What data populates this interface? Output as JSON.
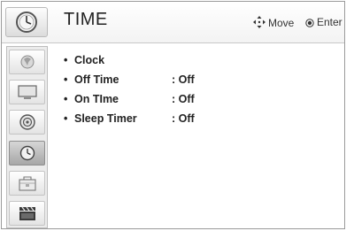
{
  "header": {
    "title": "TIME",
    "icon": "clock-icon",
    "move_hint": "Move",
    "enter_hint": "Enter"
  },
  "sidebar": {
    "items": [
      {
        "name": "picture-icon",
        "active": false
      },
      {
        "name": "tv-screen-icon",
        "active": false
      },
      {
        "name": "speaker-icon",
        "active": false
      },
      {
        "name": "clock-icon",
        "active": true
      },
      {
        "name": "lock-box-icon",
        "active": false
      },
      {
        "name": "clapperboard-icon",
        "active": false
      }
    ]
  },
  "menu": {
    "bullet": "•",
    "items": [
      {
        "label": "Clock",
        "value": ""
      },
      {
        "label": "Off Time",
        "value": ": Off"
      },
      {
        "label": "On TIme",
        "value": ": Off"
      },
      {
        "label": "Sleep Timer",
        "value": ": Off"
      }
    ]
  },
  "colors": {
    "header_bg": "#f3f3f3",
    "sidebar_bg": "#ececec",
    "active_item": "#a7a7a7",
    "text": "#222222"
  }
}
